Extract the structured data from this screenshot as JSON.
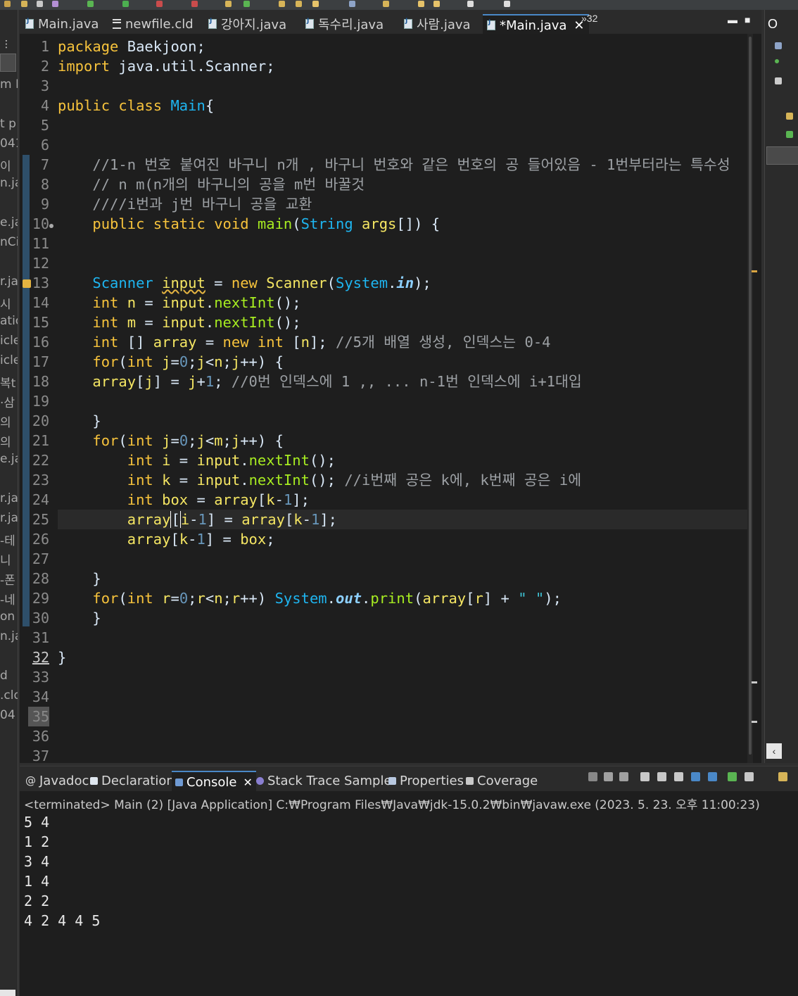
{
  "editor_tabs": [
    {
      "label": "Main.java",
      "icon": "java-file-icon",
      "active": false
    },
    {
      "label": "newfile.cld",
      "icon": "cld-file-icon",
      "active": false
    },
    {
      "label": "강아지.java",
      "icon": "java-file-icon",
      "active": false
    },
    {
      "label": "독수리.java",
      "icon": "java-file-icon",
      "active": false
    },
    {
      "label": "사람.java",
      "icon": "java-file-icon",
      "active": false
    },
    {
      "label": "*Main.java",
      "icon": "java-file-icon",
      "active": true
    }
  ],
  "tab_overflow": "»32",
  "right_panel": {
    "title": "O"
  },
  "left_fragments": [
    "m L",
    "t p",
    "041",
    "이",
    "n.ja",
    "e.ja",
    "nCi",
    "r.jav",
    "시",
    "atio",
    "icle",
    "icle",
    "복t",
    "·삼",
    "의",
    "의",
    "e.jav",
    "r.jav",
    "r.jav",
    "-테",
    "니",
    "-폰",
    "-네",
    "on",
    "n.ja",
    "d",
    ".cld",
    "04"
  ],
  "code": {
    "line_numbers": [
      "1",
      "2",
      "3",
      "4",
      "5",
      "6",
      "7",
      "8",
      "9",
      "10",
      "11",
      "12",
      "13",
      "14",
      "15",
      "16",
      "17",
      "18",
      "19",
      "20",
      "21",
      "22",
      "23",
      "24",
      "25",
      "26",
      "27",
      "28",
      "29",
      "30",
      "31",
      "32",
      "33",
      "34",
      "35",
      "36",
      "37"
    ],
    "comments": {
      "c7": "//1-n 번호 붙여진 바구니 n개 , 바구니 번호와 같은 번호의 공 들어있음 - 1번부터라는 특수성",
      "c8": "// n m(n개의 바구니의 공을 m번 바꿀것",
      "c9": "////i번과 j번 바구니 공을 교환",
      "c16": "//5개 배열 생성, 인덱스는 0-4",
      "c18": "//0번 인덱스에 1 ,, ... n-1번 인덱스에 i+1대입",
      "c23": "//i번째 공은 k에, k번째 공은 i에"
    }
  },
  "console_tabs": [
    {
      "label": "Javadoc",
      "active": false
    },
    {
      "label": "Declaration",
      "active": false
    },
    {
      "label": "Console",
      "active": true
    },
    {
      "label": "Stack Trace Sample",
      "active": false
    },
    {
      "label": "Properties",
      "active": false
    },
    {
      "label": "Coverage",
      "active": false
    }
  ],
  "console": {
    "status": "<terminated> Main (2) [Java Application] C:₩Program Files₩Java₩jdk-15.0.2₩bin₩javaw.exe  (2023. 5. 23. 오후 11:00:23)",
    "output": [
      "5 4",
      "1 2",
      "3 4",
      "1 4",
      "2 2",
      "4 2 4 4 5"
    ]
  },
  "colors": {
    "background": "#1e1e1e",
    "keyword": "#f7c33c",
    "type": "#1eb5f0",
    "comment": "#9da1a5",
    "method": "#a7ec21",
    "number": "#6897bb",
    "accent": "#4a88c7"
  }
}
